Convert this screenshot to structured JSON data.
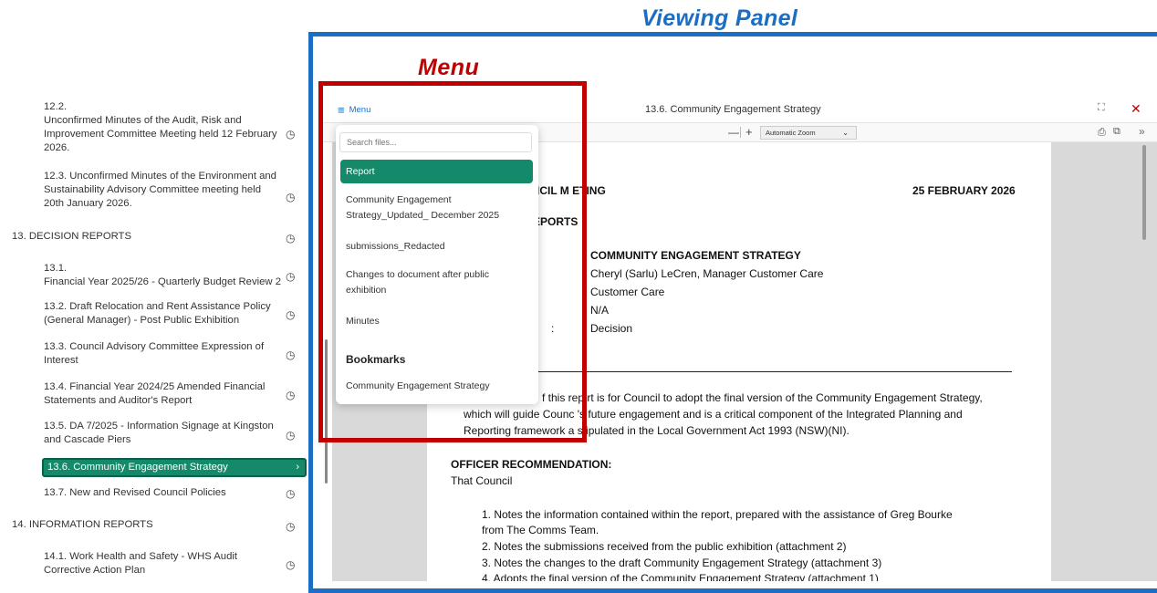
{
  "annotations": {
    "viewing_panel": "Viewing Panel",
    "menu": "Menu",
    "viewing_color": "#1a6fc4",
    "menu_color": "#c00000"
  },
  "agenda": {
    "items": [
      {
        "text": "12.2.\nUnconfirmed Minutes of the Audit, Risk and Improvement Committee Meeting held 12 February 2026."
      },
      {
        "text": "12.3. Unconfirmed Minutes of the Environment and Sustainability Advisory Committee meeting held 20th January 2026."
      },
      {
        "text": "13. DECISION REPORTS"
      },
      {
        "text": "13.1.\nFinancial Year 2025/26 - Quarterly Budget Review 2"
      },
      {
        "text": "13.2. Draft Relocation and Rent Assistance Policy (General Manager) - Post Public Exhibition"
      },
      {
        "text": "13.3. Council Advisory Committee Expression of Interest"
      },
      {
        "text": "13.4. Financial Year 2024/25 Amended Financial Statements and Auditor's Report"
      },
      {
        "text": "13.5. DA 7/2025 - Information Signage at Kingston and Cascade Piers"
      },
      {
        "text": "13.6. Community Engagement Strategy"
      },
      {
        "text": "13.7. New and Revised Council Policies"
      },
      {
        "text": "14. INFORMATION REPORTS"
      },
      {
        "text": "14.1. Work Health and Safety - WHS Audit Corrective Action Plan"
      }
    ],
    "active_index": 8,
    "active_color": "#148a6a"
  },
  "viewer": {
    "menu_label": "Menu",
    "title": "13.6. Community Engagement Strategy",
    "zoom": "Automatic Zoom",
    "icons": [
      "hamburger-icon",
      "expand-icon",
      "close-icon",
      "print-icon",
      "download-icon",
      "more-icon"
    ]
  },
  "menu_panel": {
    "search_placeholder": "Search files...",
    "items": [
      "Report",
      "Community Engagement Strategy_Updated_ December 2025",
      "submissions_Redacted",
      "Changes to document after public exhibition",
      "Minutes"
    ],
    "bookmarks_heading": "Bookmarks",
    "bookmarks": [
      "Community Engagement Strategy"
    ]
  },
  "document": {
    "header_left": "UNCIL M  ETING",
    "header_right": "25 FEBRUARY 2026",
    "section": "EPORTS",
    "subject": "COMMUNITY ENGAGEMENT STRATEGY",
    "author": "Cheryl (Sarlu) LeCren, Manager Customer Care",
    "unit": "Customer Care",
    "ref": "N/A",
    "type_label": ":",
    "type": "Decision",
    "purpose_l1": "f this rep  rt is for Council to adopt the final version of the Community Engagement Strategy,",
    "purpose_l2": "which will guide Counc   's future engagement and is a critical component of the Integrated Planning and",
    "purpose_l3": "Reporting framework a  stipulated in the Local Government Act 1993 (NSW)(NI).",
    "rec_heading": "OFFICER RECOMMENDATION:",
    "rec_intro": "That Council",
    "recs": [
      "1.   Notes the information contained within the report, prepared with the assistance of Greg Bourke",
      "      from The Comms Team.",
      "2.   Notes the submissions received from the public exhibition (attachment 2)",
      "3.   Notes the changes to the draft Community Engagement Strategy (attachment 3)",
      "4.   Adopts the final version of the Community Engagement Strategy (attachment 1)"
    ]
  }
}
